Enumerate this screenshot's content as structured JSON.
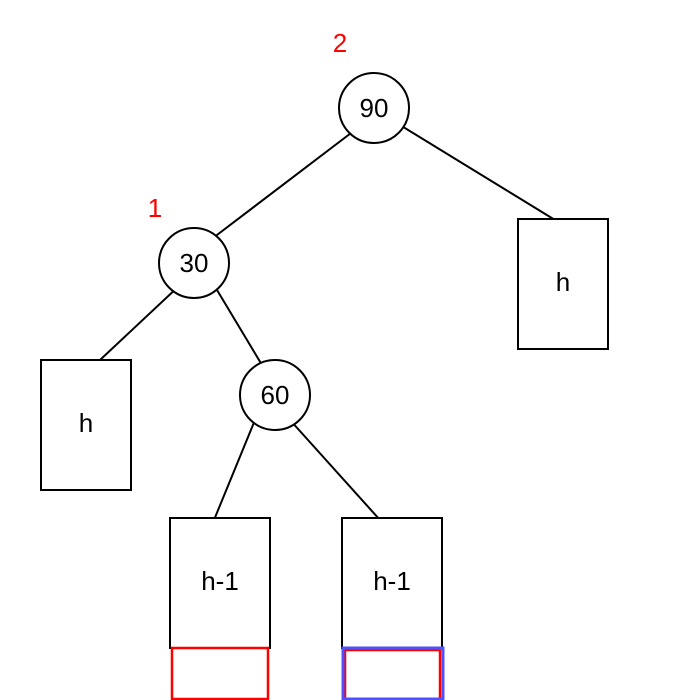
{
  "annotations": {
    "root": "2",
    "left_child": "1"
  },
  "nodes": {
    "root": {
      "value": "90"
    },
    "n30": {
      "value": "30"
    },
    "n60": {
      "value": "60"
    }
  },
  "subtrees": {
    "root_right": {
      "label": "h"
    },
    "n30_left": {
      "label": "h"
    },
    "n60_left": {
      "label": "h-1"
    },
    "n60_right": {
      "label": "h-1"
    }
  }
}
